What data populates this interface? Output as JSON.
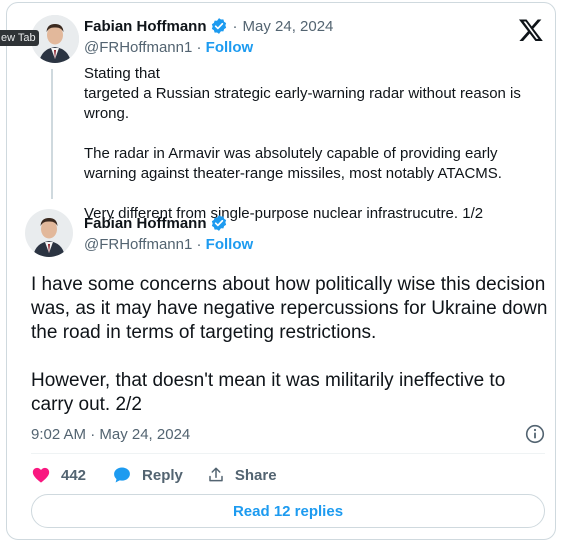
{
  "tooltip": {
    "label": "ew Tab"
  },
  "quoted_tweet": {
    "author_name": "Fabian Hoffmann",
    "date": "May 24, 2024",
    "handle": "@FRHoffmann1",
    "follow_label": "Follow",
    "line1_before_flag": "Stating that ",
    "line1_after_flag": " targeted a Russian strategic early-warning radar without reason is wrong.",
    "paragraph2": "The radar in Armavir was absolutely capable of providing early warning against theater-range missiles, most notably ATACMS.",
    "paragraph3": "Very different from single-purpose nuclear infrastrucutre. 1/2"
  },
  "main_tweet": {
    "author_name": "Fabian Hoffmann",
    "handle": "@FRHoffmann1",
    "follow_label": "Follow",
    "paragraph1": "I have some concerns about how politically wise this decision was, as it may have negative repercussions for Ukraine down the road in terms of targeting restrictions.",
    "paragraph2": "However, that doesn't mean it was militarily ineffective to carry out. 2/2",
    "timestamp": "9:02 AM · May 24, 2024"
  },
  "actions": {
    "like_count": "442",
    "reply_label": "Reply",
    "share_label": "Share"
  },
  "read_replies_label": "Read 12 replies",
  "colors": {
    "accent": "#1d9bf0",
    "like": "#f91880",
    "secondary_text": "#536471",
    "flag_blue": "#2a6ad6",
    "flag_yellow": "#f6d130"
  },
  "icons": [
    "x-logo-icon",
    "verified-badge-icon",
    "heart-icon",
    "reply-bubble-icon",
    "share-icon",
    "info-icon",
    "ukraine-flag-emoji"
  ]
}
